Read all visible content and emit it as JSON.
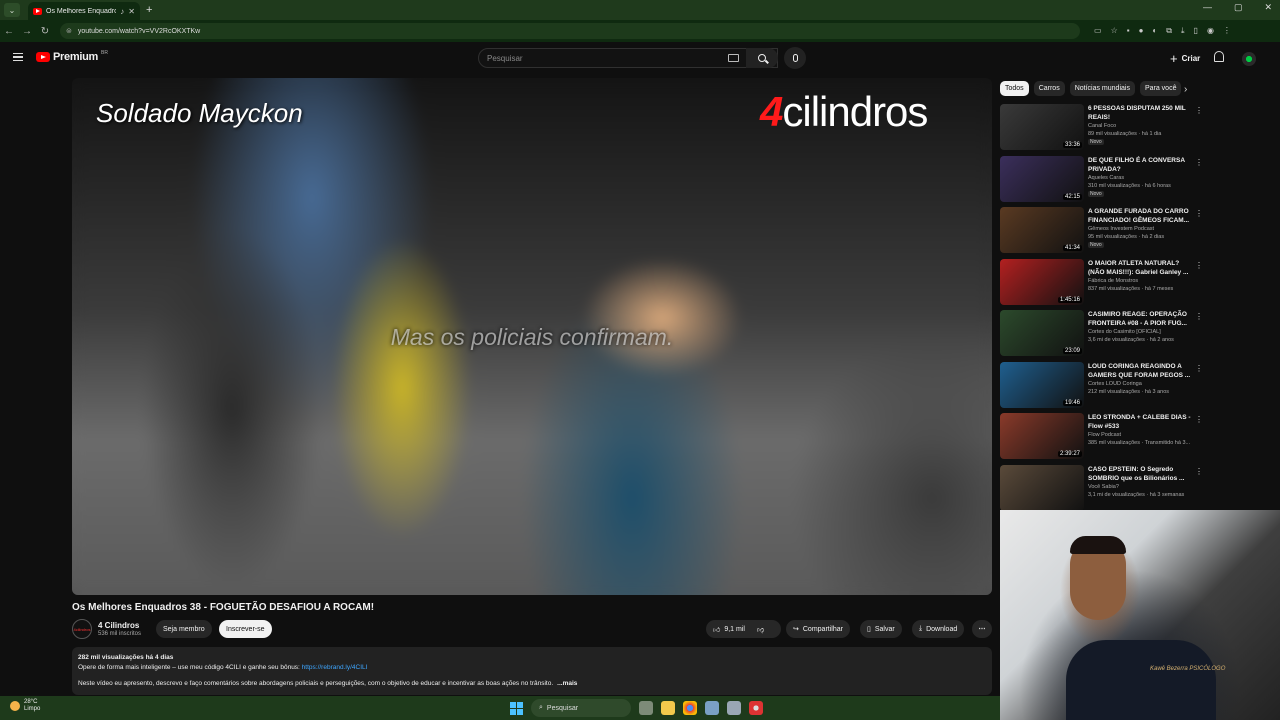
{
  "browser": {
    "tab_title": "Os Melhores Enquadros 38",
    "url": "youtube.com/watch?v=VV2RcOKXTKw"
  },
  "header": {
    "logo_text": "Premium",
    "logo_sup": "BR",
    "search_placeholder": "Pesquisar",
    "create_label": "Criar"
  },
  "player": {
    "overlay_name": "Soldado Mayckon",
    "overlay_logo_num": "4",
    "overlay_logo_text": "cilindros",
    "caption": "Mas os policiais confirmam."
  },
  "video": {
    "title": "Os Melhores Enquadros 38 - FOGUETÃO DESAFIOU A ROCAM!",
    "channel_name": "4 Cilindros",
    "channel_avatar_text": "4cilindros",
    "subscribers": "536 mil inscritos",
    "member_label": "Seja membro",
    "subscribe_label": "Inscrever-se",
    "likes": "9,1 mil",
    "share_label": "Compartilhar",
    "save_label": "Salvar",
    "download_label": "Download"
  },
  "description": {
    "meta": "282 mil visualizações  há 4 dias",
    "line1": "Opere de forma mais inteligente – use meu código 4CILI e ganhe seu bônus: ",
    "link": "https://rebrand.ly/4CILI",
    "line2": "Neste vídeo eu apresento, descrevo e faço comentários sobre abordagens policiais e perseguições, com o objetivo de educar e incentivar as boas ações no trânsito.",
    "more": "...mais"
  },
  "chips": [
    "Todos",
    "Carros",
    "Notícias mundiais",
    "Para você"
  ],
  "related": [
    {
      "title": "6 PESSOAS DISPUTAM 250 MIL REAIS!",
      "channel": "Canal Foco",
      "meta": "89 mil visualizações · há 1 dia",
      "badge": "Novo",
      "duration": "33:36",
      "color": "#3a3a3a"
    },
    {
      "title": "DE QUE FILHO É A CONVERSA PRIVADA?",
      "channel": "Aqueles Caras",
      "meta": "310 mil visualizações · há 6 horas",
      "badge": "Novo",
      "duration": "42:15",
      "color": "#3b2f5c"
    },
    {
      "title": "A GRANDE FURADA DO CARRO FINANCIADO! GÊMEOS FICAM...",
      "channel": "Gêmeos Investem Podcast",
      "meta": "95 mil visualizações · há 2 dias",
      "badge": "Novo",
      "duration": "41:34",
      "color": "#5a3a22"
    },
    {
      "title": "O MAIOR ATLETA NATURAL? (NÃO MAIS!!!): Gabriel Ganley ...",
      "channel": "Fábrica de Monstros",
      "meta": "837 mil visualizações · há 7 meses",
      "badge": "",
      "duration": "1:45:16",
      "color": "#b32020"
    },
    {
      "title": "CASIMIRO REAGE: OPERAÇÃO FRONTEIRA #08 - A PIOR FUG...",
      "channel": "Cortes do Casimito [OFICIAL]",
      "meta": "3,6 mi de visualizações · há 2 anos",
      "badge": "",
      "duration": "23:09",
      "color": "#2c4a2c"
    },
    {
      "title": "LOUD CORINGA REAGINDO A GAMERS QUE FORAM PEGOS ...",
      "channel": "Cortes LOUD Coringa",
      "meta": "212 mil visualizações · há 3 anos",
      "badge": "",
      "duration": "19:46",
      "color": "#1f5f8f"
    },
    {
      "title": "LEO STRONDA + CALEBE DIAS - Flow #533",
      "channel": "Flow Podcast",
      "meta": "385 mil visualizações · Transmitido há 3...",
      "badge": "",
      "duration": "2:39:27",
      "color": "#8a3a2a"
    },
    {
      "title": "CASO EPSTEIN: O Segredo SOMBRIO que os Bilionários ...",
      "channel": "Você Sabia?",
      "meta": "3,1 mi de visualizações · há 3 semanas",
      "badge": "",
      "duration": "",
      "color": "#5a4a3a"
    }
  ],
  "webcam": {
    "shirt_print": "Kawê Bezerra PSICÓLOGO"
  },
  "taskbar": {
    "temperature": "28°C",
    "weather": "Limpo",
    "search": "Pesquisar"
  }
}
